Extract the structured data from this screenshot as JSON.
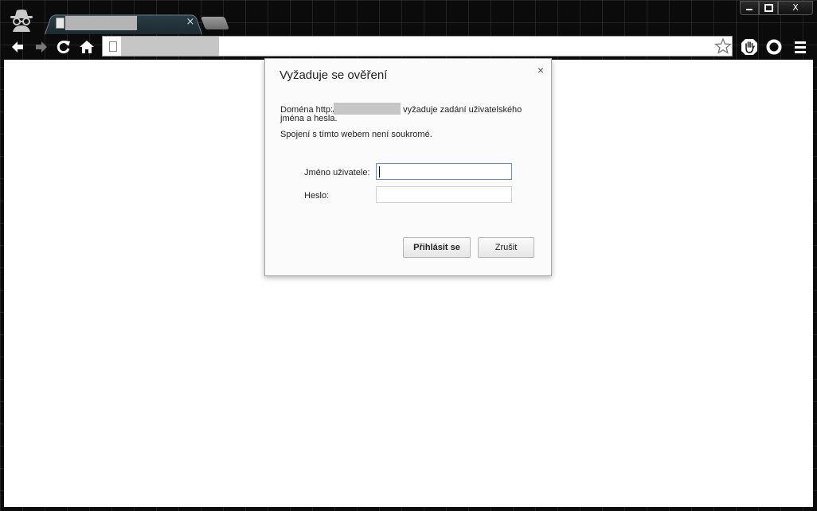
{
  "browser": {
    "tab": {
      "title": "",
      "close_glyph": "×"
    },
    "omnibox": {
      "url": ""
    },
    "icons": {
      "incognito": "incognito-icon",
      "back": "back-arrow-icon",
      "forward": "forward-arrow-icon",
      "reload": "reload-icon",
      "home": "home-icon",
      "star": "star-icon",
      "extension_hand": "hand-extension-icon",
      "extension_circle": "circle-extension-icon",
      "menu": "menu-icon"
    },
    "window_controls": {
      "close_glyph": "X"
    }
  },
  "dialog": {
    "title": "Vyžaduje se ověření",
    "close_glyph": "×",
    "message_prefix": "Doména http:/",
    "message_suffix": "vyžaduje zadání uživatelského",
    "message_line2": "jména a hesla.",
    "privacy_note": "Spojení s tímto webem není soukromé.",
    "username_label": "Jméno uživatele:",
    "username_value": "",
    "password_label": "Heslo:",
    "password_value": "",
    "login_button": "Přihlásit se",
    "cancel_button": "Zrušit"
  },
  "colors": {
    "frame": "#0b0b0b",
    "focus_border": "#5e8fd3",
    "redaction": "#c6c6c6"
  }
}
